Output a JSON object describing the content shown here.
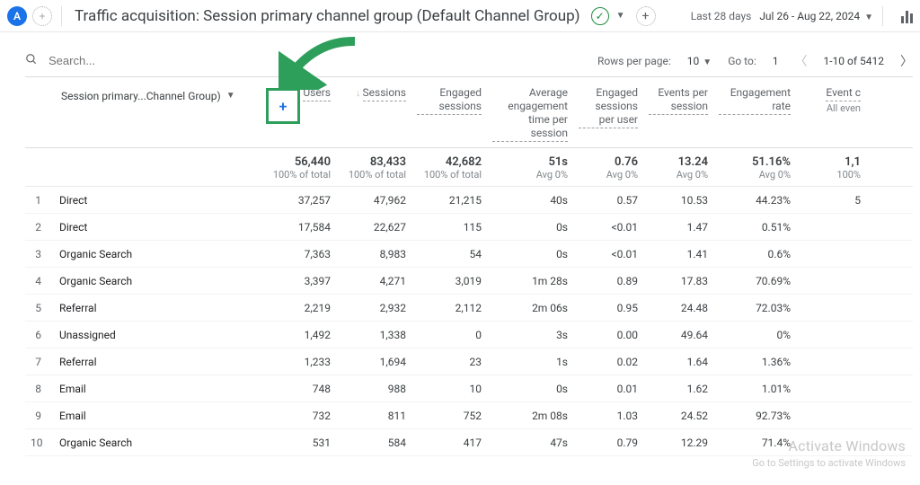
{
  "header": {
    "title": "Traffic acquisition: Session primary channel group (Default Channel Group)",
    "date_range_label": "Last 28 days",
    "date_range": "Jul 26 - Aug 22, 2024"
  },
  "search": {
    "placeholder": "Search..."
  },
  "pager": {
    "rows_per_page_label": "Rows per page:",
    "rows_per_page": "10",
    "goto_label": "Go to:",
    "goto": "1",
    "range": "1-10 of 5412"
  },
  "columns": {
    "dimension": "Session primary...Channel Group)",
    "metrics": [
      "Users",
      "Sessions",
      "Engaged sessions",
      "Average engagement time per session",
      "Engaged sessions per user",
      "Events per session",
      "Engagement rate",
      "Event c"
    ],
    "trailing_sub": "All even"
  },
  "summary": [
    {
      "big": "56,440",
      "sub": "100% of total"
    },
    {
      "big": "83,433",
      "sub": "100% of total"
    },
    {
      "big": "42,682",
      "sub": "100% of total"
    },
    {
      "big": "51s",
      "sub": "Avg 0%"
    },
    {
      "big": "0.76",
      "sub": "Avg 0%"
    },
    {
      "big": "13.24",
      "sub": "Avg 0%"
    },
    {
      "big": "51.16%",
      "sub": "Avg 0%"
    },
    {
      "big": "1,1",
      "sub": "100%"
    }
  ],
  "rows": [
    {
      "i": "1",
      "dim": "Direct",
      "v": [
        "37,257",
        "47,962",
        "21,215",
        "40s",
        "0.57",
        "10.53",
        "44.23%",
        "5"
      ]
    },
    {
      "i": "2",
      "dim": "Direct",
      "v": [
        "17,584",
        "22,627",
        "115",
        "0s",
        "<0.01",
        "1.47",
        "0.51%",
        ""
      ]
    },
    {
      "i": "3",
      "dim": "Organic Search",
      "v": [
        "7,363",
        "8,983",
        "54",
        "0s",
        "<0.01",
        "1.41",
        "0.6%",
        ""
      ]
    },
    {
      "i": "4",
      "dim": "Organic Search",
      "v": [
        "3,397",
        "4,271",
        "3,019",
        "1m 28s",
        "0.89",
        "17.83",
        "70.69%",
        ""
      ]
    },
    {
      "i": "5",
      "dim": "Referral",
      "v": [
        "2,219",
        "2,932",
        "2,112",
        "2m 06s",
        "0.95",
        "24.48",
        "72.03%",
        ""
      ]
    },
    {
      "i": "6",
      "dim": "Unassigned",
      "v": [
        "1,492",
        "1,338",
        "0",
        "3s",
        "0.00",
        "49.64",
        "0%",
        ""
      ]
    },
    {
      "i": "7",
      "dim": "Referral",
      "v": [
        "1,233",
        "1,694",
        "23",
        "1s",
        "0.02",
        "1.64",
        "1.36%",
        ""
      ]
    },
    {
      "i": "8",
      "dim": "Email",
      "v": [
        "748",
        "988",
        "10",
        "0s",
        "0.01",
        "1.62",
        "1.01%",
        ""
      ]
    },
    {
      "i": "9",
      "dim": "Email",
      "v": [
        "732",
        "811",
        "752",
        "2m 08s",
        "1.03",
        "24.52",
        "92.73%",
        ""
      ]
    },
    {
      "i": "10",
      "dim": "Organic Search",
      "v": [
        "531",
        "584",
        "417",
        "47s",
        "0.79",
        "12.29",
        "71.4%",
        ""
      ]
    }
  ],
  "watermark": {
    "line1": "Activate Windows",
    "line2": "Go to Settings to activate Windows"
  }
}
